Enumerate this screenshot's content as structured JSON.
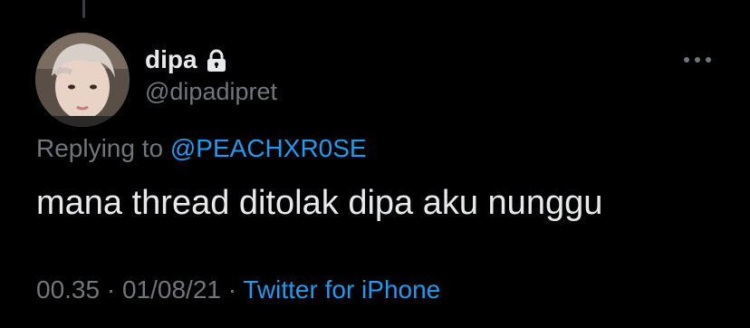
{
  "tweet": {
    "display_name": "dipa",
    "protected_icon": "lock-icon",
    "handle": "@dipadipret",
    "more_icon": "more-horizontal-icon",
    "replying_prefix": "Replying to ",
    "replying_to": "@PEACHXR0SE",
    "text": "mana thread ditolak dipa aku nunggu",
    "time": "00.35",
    "separator_1": " · ",
    "date": "01/08/21",
    "separator_2": " · ",
    "source": "Twitter for iPhone"
  },
  "colors": {
    "background": "#000000",
    "primary_text": "#e7e9ea",
    "secondary_text": "#71767b",
    "accent": "#1d9bf0"
  }
}
